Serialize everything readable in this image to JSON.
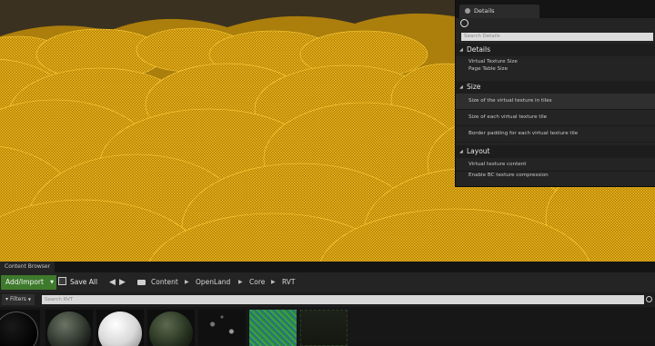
{
  "details": {
    "tab_label": "Details",
    "search_placeholder": "Search Details",
    "categories": [
      {
        "label": "Details",
        "props": [
          "Virtual Texture Size",
          "Page Table Size"
        ]
      },
      {
        "label": "Size",
        "props": [
          "Size of the virtual texture in tiles",
          "Size of each virtual texture tile",
          "Border padding for each virtual texture tile"
        ]
      },
      {
        "label": "Layout",
        "props": [
          "Virtual texture content",
          "Enable BC texture compression"
        ]
      }
    ]
  },
  "content_browser": {
    "tab_label": "Content Browser",
    "add_import_label": "Add/Import",
    "save_all_label": "Save All",
    "breadcrumbs": [
      "Content",
      "OpenLand",
      "Core",
      "RVT"
    ],
    "filters_label": "Filters",
    "search_placeholder": "Search RVT"
  },
  "colors": {
    "wireframe": "#e8a90c",
    "panel_bg": "#242424",
    "add_import_green": "#3e7a2c"
  }
}
